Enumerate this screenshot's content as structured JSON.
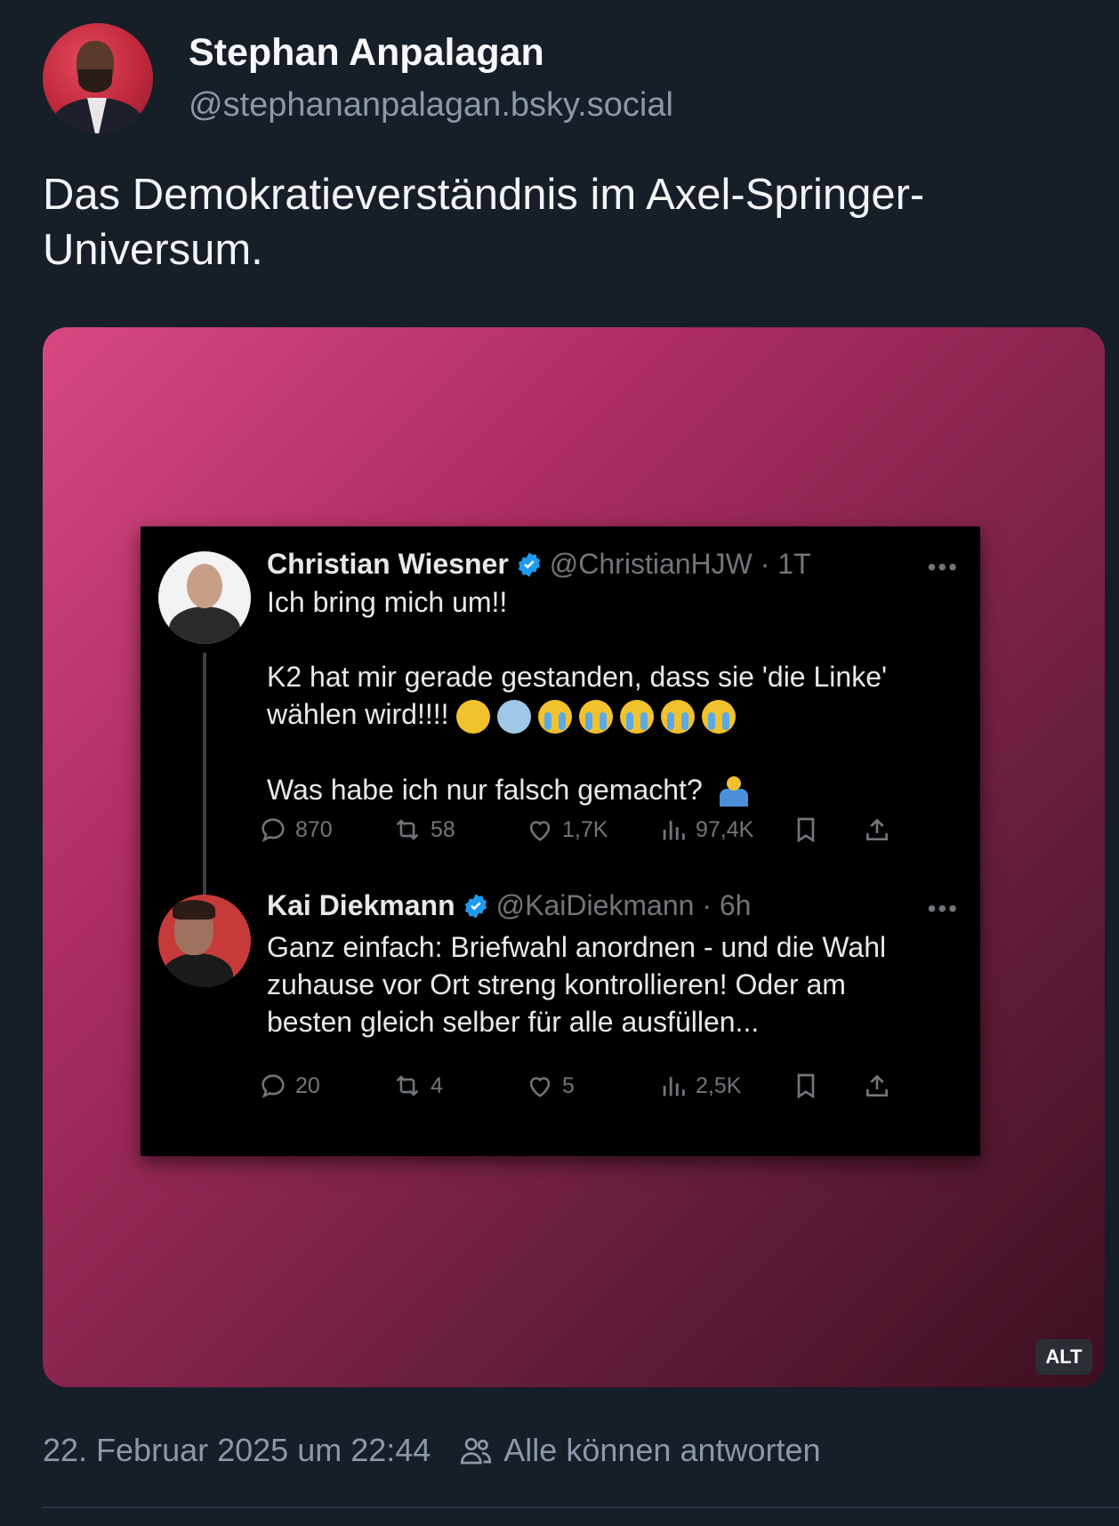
{
  "author": {
    "name": "Stephan Anpalagan",
    "handle": "@stephananpalagan.bsky.social"
  },
  "post": {
    "text": "Das Demokratieverständnis im Axel-Springer-Universum."
  },
  "embedded_screenshot": {
    "tweets": [
      {
        "name": "Christian Wiesner",
        "handle": "@ChristianHJW · 1T",
        "lines": [
          "Ich bring mich um!!",
          "K2 hat mir gerade gestanden, dass sie 'die Linke' wählen wird!!!!",
          "Was habe ich nur falsch gemacht?"
        ],
        "emojis": [
          "weary-face",
          "screaming-face",
          "crying-face",
          "crying-face",
          "crying-face",
          "crying-face",
          "crying-face"
        ],
        "stats": {
          "replies": "870",
          "reposts": "58",
          "likes": "1,7K",
          "views": "97,4K"
        }
      },
      {
        "name": "Kai Diekmann",
        "handle": "@KaiDiekmann · 6h",
        "lines": [
          "Ganz einfach: Briefwahl anordnen - und die Wahl zuhause vor Ort streng kontrollieren! Oder am besten gleich selber für alle ausfüllen..."
        ],
        "stats": {
          "replies": "20",
          "reposts": "4",
          "likes": "5",
          "views": "2,5K"
        }
      }
    ]
  },
  "alt_badge": "ALT",
  "footer": {
    "date": "22. Februar 2025 um 22:44",
    "reply_setting": "Alle können antworten"
  },
  "colors": {
    "background": "#161e27",
    "accent_pink": "#d84880",
    "verified_blue": "#1d9bf0"
  }
}
